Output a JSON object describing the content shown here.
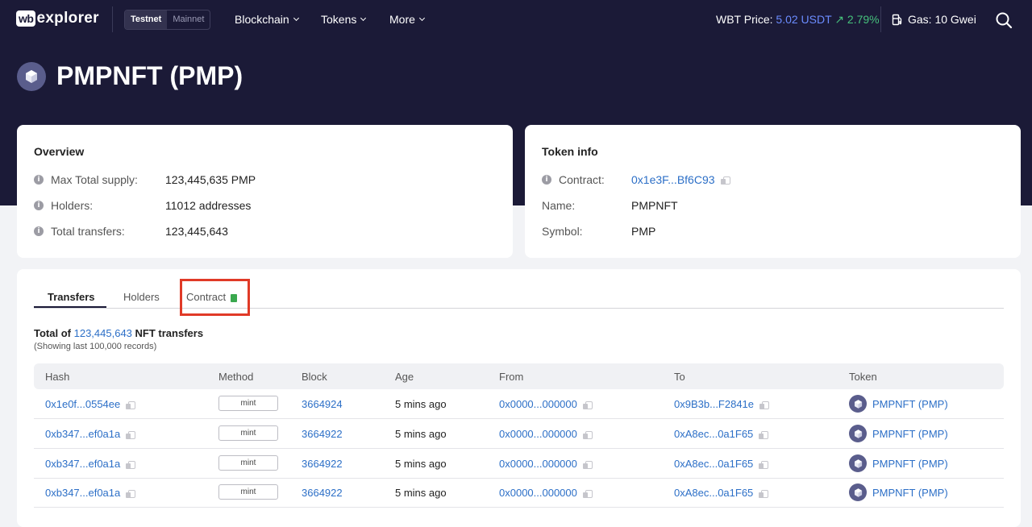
{
  "header": {
    "logo_badge": "wb",
    "logo_text": "explorer",
    "network": {
      "testnet": "Testnet",
      "mainnet": "Mainnet"
    },
    "nav": [
      "Blockchain",
      "Tokens",
      "More"
    ],
    "price_label": "WBT Price:",
    "price_value": "5.02 USDT",
    "price_change": "↗ 2.79%",
    "gas": "Gas: 10 Gwei"
  },
  "page": {
    "title": "PMPNFT (PMP)"
  },
  "overview": {
    "heading": "Overview",
    "rows": [
      {
        "label": "Max Total supply:",
        "value": "123,445,635 PMP"
      },
      {
        "label": "Holders:",
        "value": "11012 addresses"
      },
      {
        "label": "Total transfers:",
        "value": "123,445,643"
      }
    ]
  },
  "token_info": {
    "heading": "Token info",
    "contract_label": "Contract:",
    "contract_value": "0x1e3F...Bf6C93",
    "name_label": "Name:",
    "name_value": "PMPNFT",
    "symbol_label": "Symbol:",
    "symbol_value": "PMP"
  },
  "tabs": [
    "Transfers",
    "Holders",
    "Contract"
  ],
  "summary": {
    "prefix": "Total of",
    "count": "123,445,643",
    "suffix": "NFT transfers",
    "note": "(Showing last 100,000 records)"
  },
  "table": {
    "columns": [
      "Hash",
      "Method",
      "Block",
      "Age",
      "From",
      "To",
      "Token"
    ],
    "rows": [
      {
        "hash": "0x1e0f...0554ee",
        "method": "mint",
        "block": "3664924",
        "age": "5 mins ago",
        "from": "0x0000...000000",
        "to": "0x9B3b...F2841e",
        "token": "PMPNFT (PMP)"
      },
      {
        "hash": "0xb347...ef0a1a",
        "method": "mint",
        "block": "3664922",
        "age": "5 mins ago",
        "from": "0x0000...000000",
        "to": "0xA8ec...0a1F65",
        "token": "PMPNFT (PMP)"
      },
      {
        "hash": "0xb347...ef0a1a",
        "method": "mint",
        "block": "3664922",
        "age": "5 mins ago",
        "from": "0x0000...000000",
        "to": "0xA8ec...0a1F65",
        "token": "PMPNFT (PMP)"
      },
      {
        "hash": "0xb347...ef0a1a",
        "method": "mint",
        "block": "3664922",
        "age": "5 mins ago",
        "from": "0x0000...000000",
        "to": "0xA8ec...0a1F65",
        "token": "PMPNFT (PMP)"
      }
    ]
  }
}
